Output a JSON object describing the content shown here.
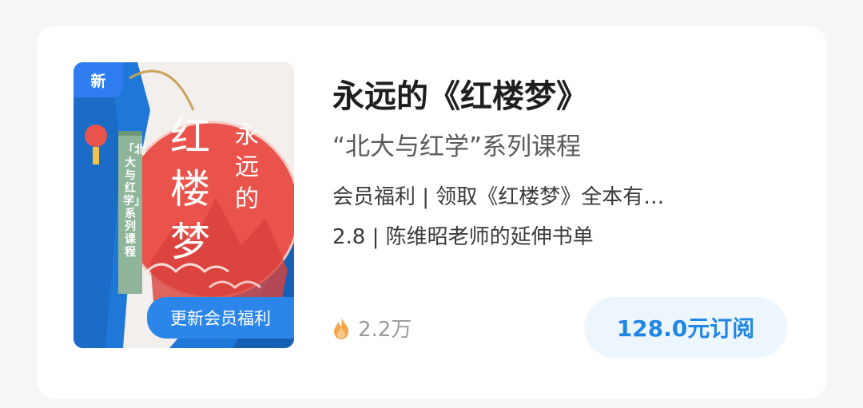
{
  "course": {
    "title": "永远的《红楼梦》",
    "subtitle": "“北大与红学”系列课程",
    "description_lines": [
      "会员福利 | 领取《红楼梦》全本有…",
      "2.8 | 陈维昭老师的延伸书单"
    ],
    "views": "2.2万",
    "subscribe_label": "128.0元订阅"
  },
  "cover": {
    "badge": "新",
    "title_main": "红楼梦",
    "title_side": "永远的",
    "series_text": "「北大与红学」系列课程",
    "banner": "更新会员福利"
  },
  "icons": {
    "views": "flame-icon"
  },
  "colors": {
    "accent_blue": "#2f7df0",
    "cover_red": "#e9534c",
    "subscribe_text": "#1f86e6",
    "subscribe_bg": "#eef6fd"
  }
}
